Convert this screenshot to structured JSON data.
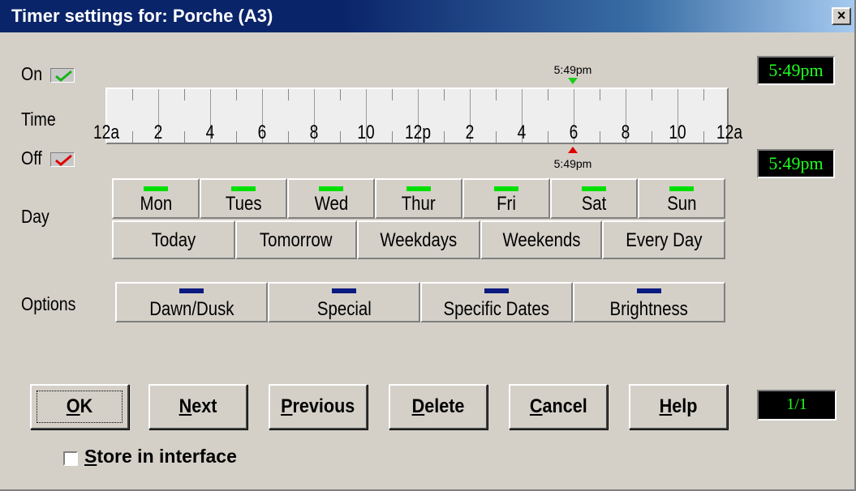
{
  "window": {
    "title": "Timer settings for: Porche (A3)",
    "close_label": "×"
  },
  "on": {
    "label": "On",
    "checked": true,
    "marker_time": "5:49pm",
    "digital": "5:49pm"
  },
  "off": {
    "label": "Off",
    "checked": true,
    "marker_time": "5:49pm",
    "digital": "5:49pm"
  },
  "time": {
    "label": "Time",
    "ticks": [
      "12a",
      "2",
      "4",
      "6",
      "8",
      "10",
      "12p",
      "2",
      "4",
      "6",
      "8",
      "10",
      "12a"
    ]
  },
  "day": {
    "label": "Day",
    "days": [
      {
        "label": "Mon",
        "indicator": "green"
      },
      {
        "label": "Tues",
        "indicator": "green"
      },
      {
        "label": "Wed",
        "indicator": "green"
      },
      {
        "label": "Thur",
        "indicator": "green"
      },
      {
        "label": "Fri",
        "indicator": "green"
      },
      {
        "label": "Sat",
        "indicator": "green"
      },
      {
        "label": "Sun",
        "indicator": "green"
      }
    ],
    "presets": [
      "Today",
      "Tomorrow",
      "Weekdays",
      "Weekends",
      "Every Day"
    ]
  },
  "options": {
    "label": "Options",
    "items": [
      {
        "label": "Dawn/Dusk",
        "indicator": "navy"
      },
      {
        "label": "Special",
        "indicator": "navy"
      },
      {
        "label": "Specific Dates",
        "indicator": "navy"
      },
      {
        "label": "Brightness",
        "indicator": "navy"
      }
    ]
  },
  "buttons": {
    "ok": {
      "first": "O",
      "rest": "K"
    },
    "next": {
      "first": "N",
      "rest": "ext"
    },
    "previous": {
      "first": "P",
      "rest": "revious"
    },
    "delete": {
      "first": "D",
      "rest": "elete"
    },
    "cancel": {
      "first": "C",
      "rest": "ancel"
    },
    "help": {
      "first": "H",
      "rest": "elp"
    }
  },
  "page_indicator": "1/1",
  "store": {
    "first": "S",
    "rest": "tore in interface",
    "checked": false
  },
  "colors": {
    "on_green": "#1eff1e",
    "off_red": "#e00000",
    "indicator_green": "#00e000",
    "indicator_navy": "#0a1a80"
  }
}
